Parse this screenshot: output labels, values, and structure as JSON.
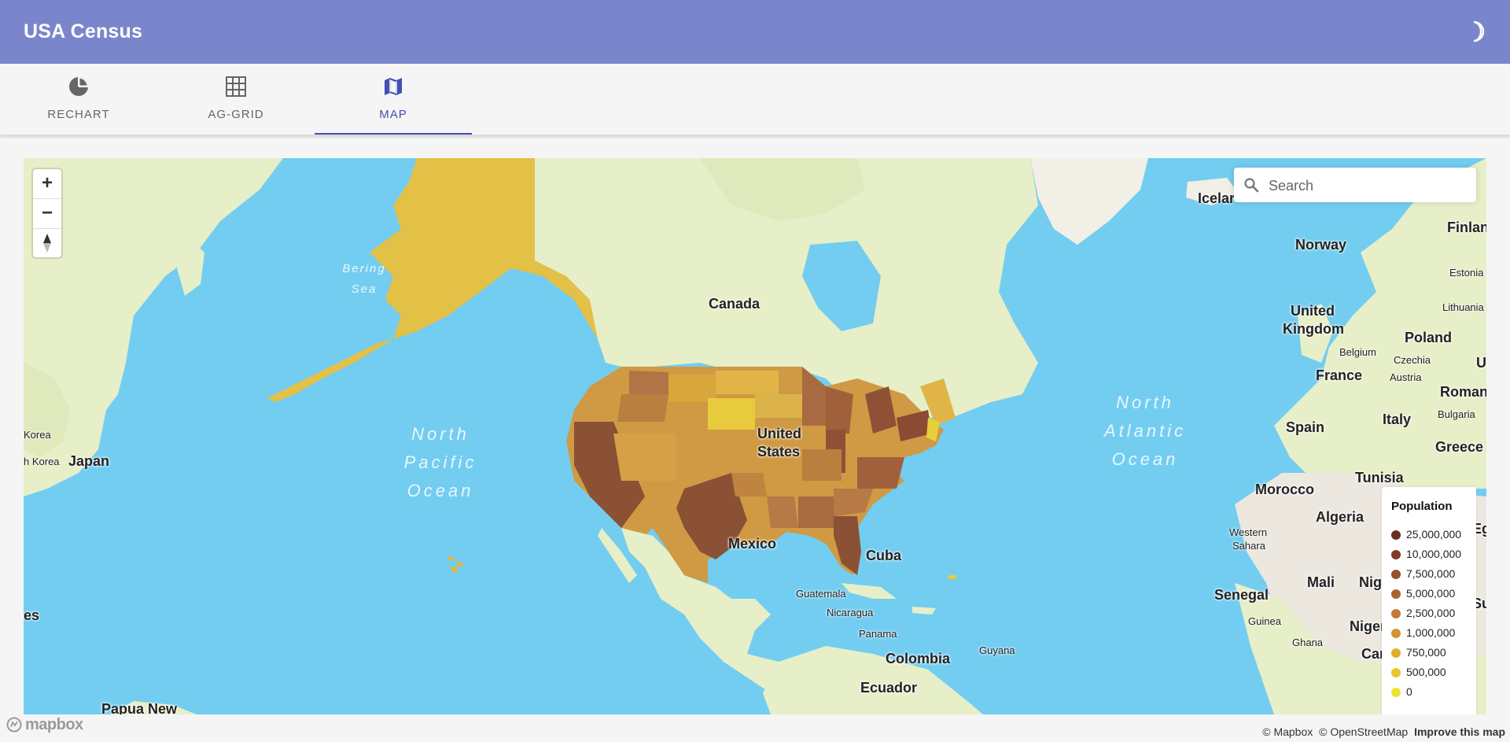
{
  "app": {
    "title": "USA Census",
    "theme_toggle_icon": "moon-icon"
  },
  "tabs": [
    {
      "label": "RECHART",
      "icon": "pie-chart-icon",
      "active": false
    },
    {
      "label": "AG-GRID",
      "icon": "grid-table-icon",
      "active": false
    },
    {
      "label": "MAP",
      "icon": "map-icon",
      "active": true
    }
  ],
  "map": {
    "zoom_in": "+",
    "zoom_out": "−",
    "search": {
      "placeholder": "Search",
      "value": ""
    },
    "labels": {
      "canada": "Canada",
      "united_states_1": "United",
      "united_states_2": "States",
      "mexico": "Mexico",
      "cuba": "Cuba",
      "guatemala": "Guatemala",
      "nicaragua": "Nicaragua",
      "panama": "Panama",
      "colombia": "Colombia",
      "ecuador": "Ecuador",
      "guyana": "Guyana",
      "japan": "Japan",
      "korea": "Korea",
      "h_korea": "h Korea",
      "papua_new": "Papua New",
      "es": "es",
      "iceland": "Icelar",
      "norway": "Norway",
      "finland": "Finlan",
      "estonia": "Estonia",
      "lithuania": "Lithuania",
      "united_kingdom_1": "United",
      "united_kingdom_2": "Kingdom",
      "belgium": "Belgium",
      "czechia": "Czechia",
      "poland": "Poland",
      "austria": "Austria",
      "france": "France",
      "romania": "Romani",
      "bulgaria": "Bulgaria",
      "u_edge": "U",
      "spain": "Spain",
      "italy": "Italy",
      "greece": "Greece",
      "tunisia": "Tunisia",
      "morocco": "Morocco",
      "algeria": "Algeria",
      "western_sahara_1": "Western",
      "western_sahara_2": "Sahara",
      "mali": "Mali",
      "niger_1": "Nig",
      "niger_2": "Niger",
      "senegal": "Senegal",
      "guinea": "Guinea",
      "ghana": "Ghana",
      "cameroon": "Car",
      "eg": "Eg",
      "su": "Su",
      "north_pacific": [
        "North",
        "Pacific",
        "Ocean"
      ],
      "north_atlantic": [
        "North",
        "Atlantic",
        "Ocean"
      ],
      "bering_sea": [
        "Bering",
        "Sea"
      ]
    },
    "legend": {
      "title": "Population",
      "items": [
        {
          "label": "25,000,000",
          "color": "#6b2e1e"
        },
        {
          "label": "10,000,000",
          "color": "#7f3b24"
        },
        {
          "label": "7,500,000",
          "color": "#955030"
        },
        {
          "label": "5,000,000",
          "color": "#ab6333"
        },
        {
          "label": "2,500,000",
          "color": "#c27b32"
        },
        {
          "label": "1,000,000",
          "color": "#d39433"
        },
        {
          "label": "750,000",
          "color": "#e0ad31"
        },
        {
          "label": "500,000",
          "color": "#e7c62e"
        },
        {
          "label": "0",
          "color": "#efe332"
        }
      ]
    },
    "branding": "mapbox",
    "attribution": {
      "mapbox": "© Mapbox",
      "osm": "© OpenStreetMap",
      "improve": "Improve this map"
    }
  }
}
